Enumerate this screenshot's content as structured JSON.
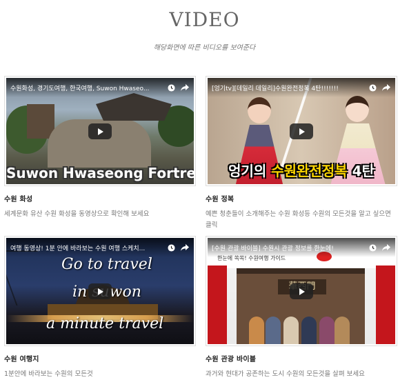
{
  "header": {
    "title": "VIDEO",
    "subtitle": "해당화면에 따른 비디오를 보여준다"
  },
  "videos": [
    {
      "overlay_title": "수원화성, 경기도여행, 한국여행, Suwon Hwaseo...",
      "thumbnail_text": "Suwon Hwaseong Fortress",
      "title": "수원 화성",
      "description": "세계문화 유산 수원 화성을 동영상으로 확인해 보세요"
    },
    {
      "overlay_title": "[엉기tv][데일리 데일리]수원완전정복 4탄!!!!!!!",
      "thumbnail_text_a": "엉기의 ",
      "thumbnail_text_b": "수원완전정복",
      "thumbnail_text_c": " 4탄",
      "title": "수원 정복",
      "description": "예쁜 청춘들이 소개해주는 수원 화성등 수원의 모든것을 알고 싶으면 클릭"
    },
    {
      "overlay_title": "여행 동영상! 1분 안에 바라보는 수원 여행 스케치...",
      "thumbnail_text_1": "Go to travel",
      "thumbnail_text_2": "in suwon",
      "thumbnail_text_3": "a minute travel",
      "title": "수원 여행지",
      "description": "1분안에 바라보는 수원의 모든것"
    },
    {
      "overlay_title": "[수원 관광 바이블] 수원시 관광 정보를 한눈에!",
      "thumbnail_text": "한눈에 쏙쏙! 수원여행 가이드",
      "sign_text": "華西門",
      "title": "수원 관광 바이블",
      "description": "과거와 현대가 공존하는 도시 수원의 모든것을 살펴 보세요"
    }
  ],
  "icons": {
    "clock": "clock-icon",
    "share": "share-icon",
    "play": "play-icon"
  },
  "colors": {
    "accent_red": "#c4161c",
    "highlight_yellow": "#ffd700"
  }
}
